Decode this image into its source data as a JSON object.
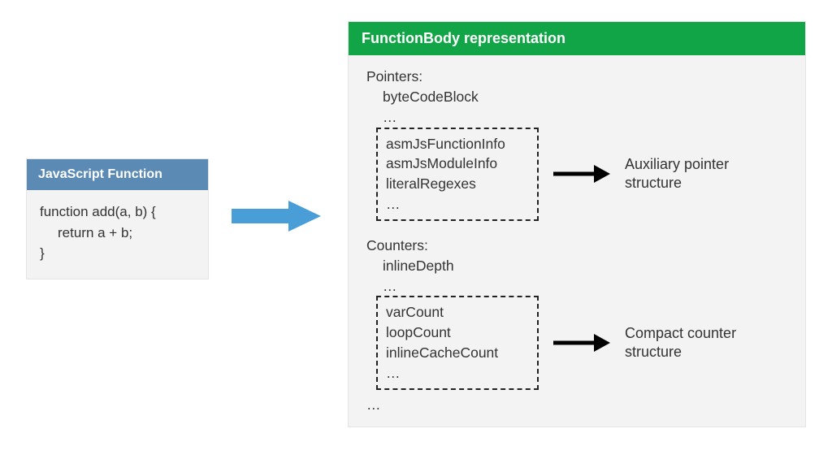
{
  "left": {
    "title": "JavaScript Function",
    "code_line1": "function add(a, b) {",
    "code_line2": "return a + b;",
    "code_line3": "}"
  },
  "right": {
    "title": "FunctionBody representation",
    "pointers_label": "Pointers:",
    "pointers_item1": "byteCodeBlock",
    "ellipsis": "…",
    "pointers_box_item1": "asmJsFunctionInfo",
    "pointers_box_item2": "asmJsModuleInfo",
    "pointers_box_item3": "literalRegexes",
    "pointers_arrow_label1": "Auxiliary pointer",
    "pointers_arrow_label2": "structure",
    "counters_label": "Counters:",
    "counters_item1": "inlineDepth",
    "counters_box_item1": "varCount",
    "counters_box_item2": "loopCount",
    "counters_box_item3": "inlineCacheCount",
    "counters_arrow_label1": "Compact counter",
    "counters_arrow_label2": "structure"
  },
  "colors": {
    "blue": "#5b8bb5",
    "green": "#12a547",
    "arrow_blue": "#4a9ed8"
  }
}
